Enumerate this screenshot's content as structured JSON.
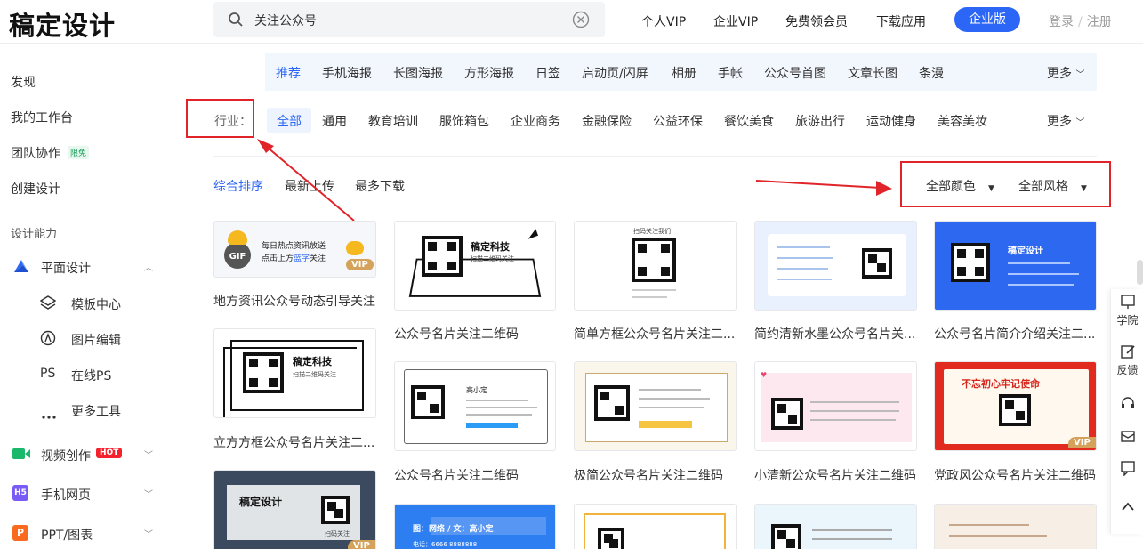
{
  "header": {
    "logo": "稿定设计",
    "search_value": "关注公众号",
    "nav": [
      "个人VIP",
      "企业VIP",
      "免费领会员",
      "下载应用"
    ],
    "enterprise_button": "企业版",
    "login": "登录",
    "register": "注册",
    "login_sep": "/"
  },
  "sidebar": {
    "discover": "发现",
    "workspace": "我的工作台",
    "team": "团队协作",
    "team_badge": "限免",
    "create": "创建设计",
    "section_label": "设计能力",
    "flat_design": "平面设计",
    "sub_items": [
      "模板中心",
      "图片编辑",
      "在线PS",
      "更多工具"
    ],
    "ps_icon_text": "PS",
    "video": "视频创作",
    "video_badge": "HOT",
    "h5": "手机网页",
    "ppt": "PPT/图表"
  },
  "categories": [
    "推荐",
    "手机海报",
    "长图海报",
    "方形海报",
    "日签",
    "启动页/闪屏",
    "相册",
    "手帐",
    "公众号首图",
    "文章长图",
    "条漫"
  ],
  "industries_label": "行业：",
  "industries": [
    "全部",
    "通用",
    "教育培训",
    "服饰箱包",
    "企业商务",
    "金融保险",
    "公益环保",
    "餐饮美食",
    "旅游出行",
    "运动健身",
    "美容美妆"
  ],
  "more": "更多",
  "sort": [
    "综合排序",
    "最新上传",
    "最多下载"
  ],
  "filters": {
    "color": "全部颜色",
    "style": "全部风格"
  },
  "cards": [
    "地方资讯公众号动态引导关注",
    "公众号名片关注二维码",
    "简单方框公众号名片关注二...",
    "简约清新水墨公众号名片关...",
    "公众号名片简介介绍关注二...",
    "立方方框公众号名片关注二...",
    "公众号名片关注二维码",
    "极简公众号名片关注二维码",
    "小清新公众号名片关注二维码",
    "党政风公众号名片关注二维码"
  ],
  "card_texts": {
    "gif_line1": "每日热点资讯放送",
    "gif_line2": "点击上方",
    "gif_line2_hl": "蓝字",
    "gif_line2_end": "关注",
    "gif": "GIF",
    "vip": "VIP",
    "brand": "稿定科技",
    "scan": "扫描二维码关注",
    "scan_follow": "扫码关注我们",
    "gaoding_design": "稿定设计",
    "gaoxiaoding": "高小定",
    "slogan": "不忘初心牢记使命",
    "scan_follow2": "扫码关注",
    "net_text": "网络 / 文：高小定",
    "net_text2": "图：网络 / 文：高小定",
    "phone": "电话：6666 8888888"
  },
  "right_tools": [
    "学院",
    "反馈"
  ]
}
